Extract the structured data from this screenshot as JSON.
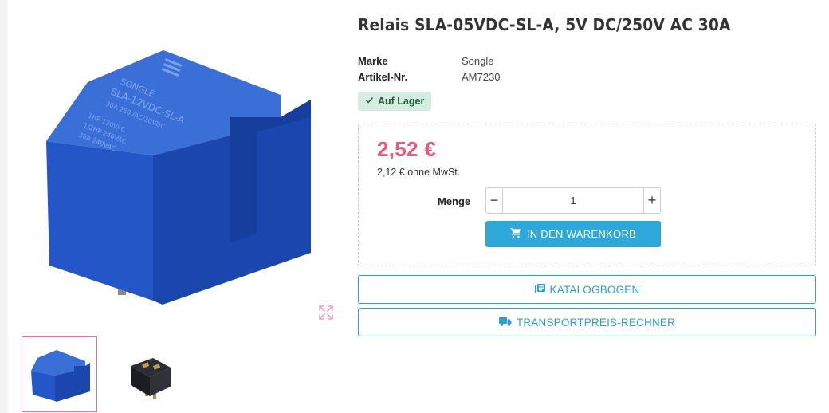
{
  "product": {
    "title": "Relais SLA-05VDC-SL-A, 5V DC/250V AC 30A",
    "specs": [
      {
        "label": "Marke",
        "value": "Songle"
      },
      {
        "label": "Artikel-Nr.",
        "value": "AM7230"
      }
    ],
    "stock": "Auf Lager"
  },
  "pricing": {
    "price": "2,52 €",
    "net_price": "2,12 € ohne MwSt."
  },
  "quantity": {
    "label": "Menge",
    "value": "1",
    "minus": "−",
    "plus": "+"
  },
  "actions": {
    "add_to_cart": "IN DEN WARENKORB",
    "catalog": "KATALOGBOGEN",
    "transport": "TRANSPORTPREIS-RECHNER"
  },
  "image": {
    "label_lines": [
      "SLA-12VDC-SL-A",
      "30A 250VAC/30VDC",
      "1HP 120VAC",
      "1/2HP 240VAC",
      "30A 240VAC"
    ],
    "brand": "SONGLE"
  },
  "colors": {
    "price": "#e8597b",
    "accent": "#2ea7db",
    "relay_blue": "#1f56c4"
  },
  "icons": {
    "zoom": "expand-icon",
    "stock": "check-icon",
    "cart": "cart-icon",
    "catalog": "catalog-icon",
    "transport": "truck-icon"
  }
}
